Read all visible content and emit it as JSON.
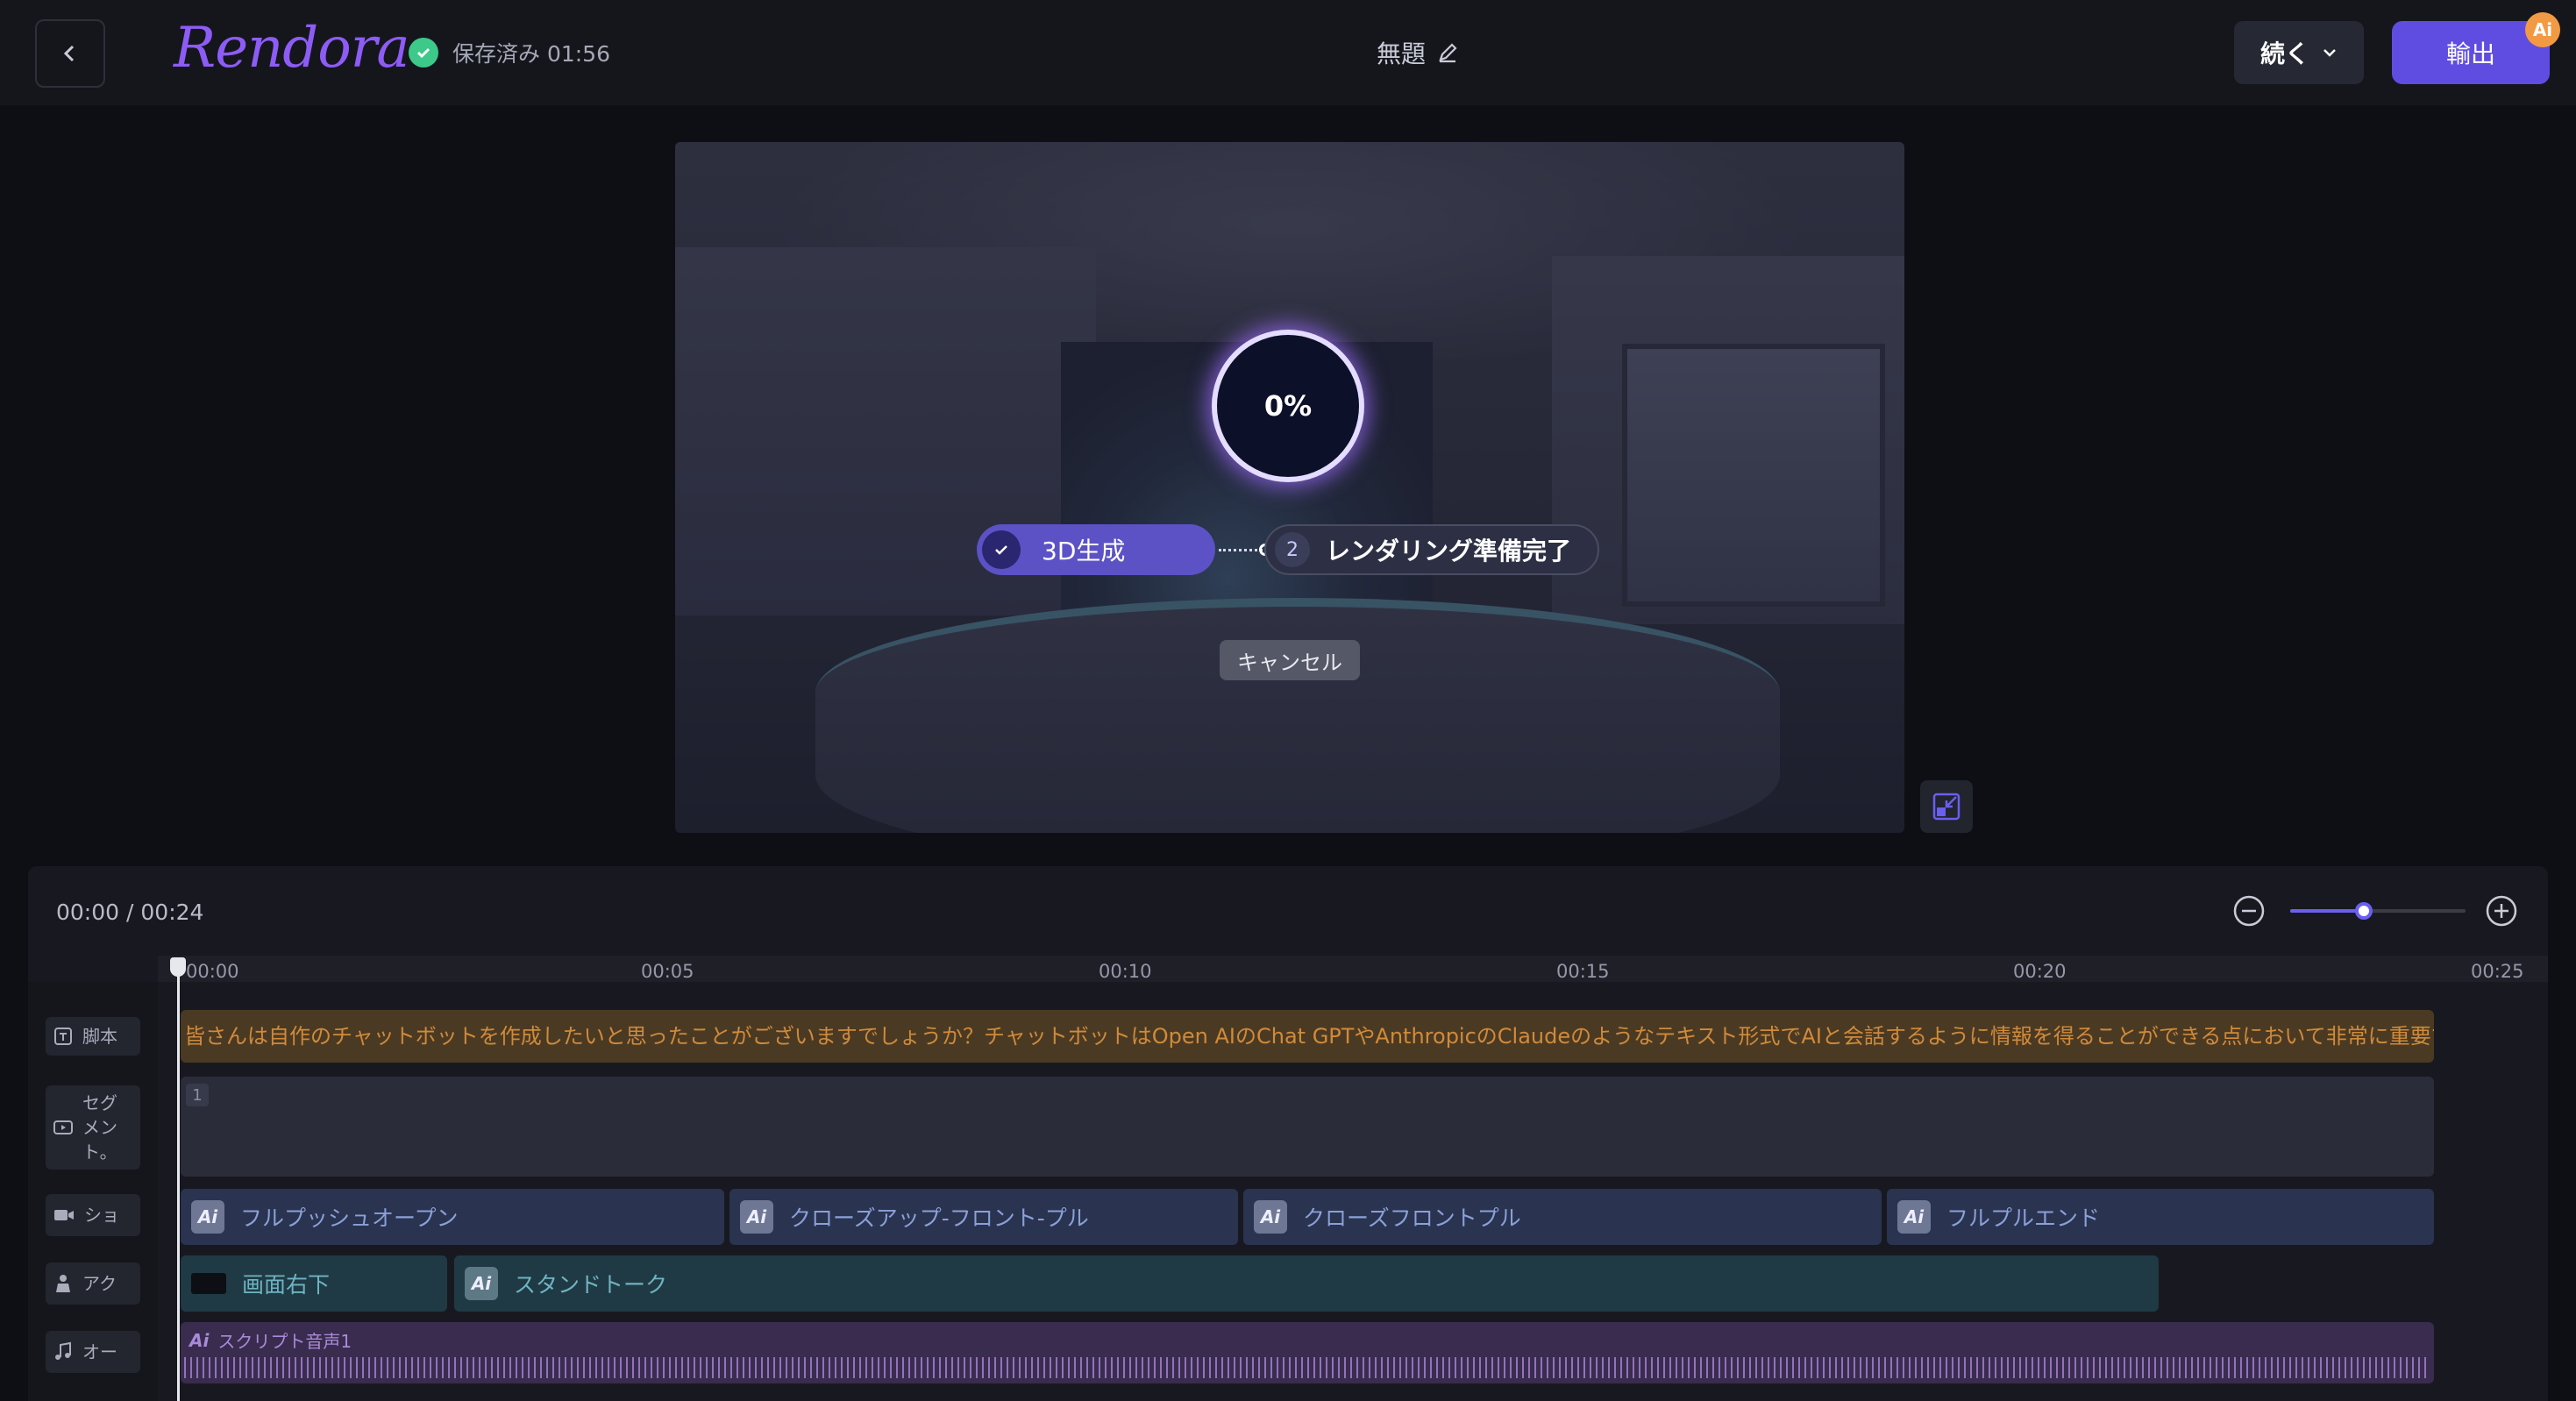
{
  "header": {
    "logo_text": "Rendora",
    "saved_status": "保存済み 01:56",
    "doc_title": "無題",
    "continue_label": "続く",
    "export_label": "輸出",
    "ai_badge": "Ai"
  },
  "preview": {
    "progress_percent": "0%",
    "step1_label": "3D生成",
    "step2_number": "2",
    "step2_label": "レンダリング準備完了",
    "cancel_label": "キャンセル"
  },
  "timeline": {
    "current_time": "00:00",
    "separator": "/",
    "total_time": "00:24",
    "zoom_level": 0.42,
    "ticks": [
      "00:00",
      "00:05",
      "00:10",
      "00:15",
      "00:20",
      "00:25"
    ],
    "tracks": {
      "script_label": "脚本",
      "segment_label": "セグメント。",
      "shot_label": "ショット",
      "action_label": "アクション",
      "audio_label": "オーディオ"
    },
    "script_text": "皆さんは自作のチャットボットを作成したいと思ったことがございますでしょうか？チャットボットはOpen AIのChat GPTやAnthropicのClaudeのようなテキスト形式でAIと会話するように情報を得ることができる点において非常に重要で",
    "segment_number": "1",
    "shots": [
      {
        "ai": "Ai",
        "label": "フルプッシュオープン"
      },
      {
        "ai": "Ai",
        "label": "クローズアップ-フロント-プル"
      },
      {
        "ai": "Ai",
        "label": "クローズフロントプル"
      },
      {
        "ai": "Ai",
        "label": "フルプルエンド"
      }
    ],
    "actions": [
      {
        "label": "画面右下"
      },
      {
        "ai": "Ai",
        "label": "スタンドトーク"
      }
    ],
    "audio": {
      "ai": "Ai",
      "label": "スクリプト音声1"
    }
  },
  "icons": {
    "back": "chevron-left-icon",
    "saved": "check-circle-icon",
    "edit": "pencil-icon",
    "dropdown": "chevron-down-icon",
    "fullscreen": "exit-fullscreen-icon",
    "zoom_out": "minus-circle-icon",
    "zoom_in": "plus-circle-icon"
  },
  "colors": {
    "accent": "#5f4de2",
    "saved_green": "#3cc98a",
    "script_orange": "#d08a3a",
    "ai_badge": "#f29a43"
  }
}
